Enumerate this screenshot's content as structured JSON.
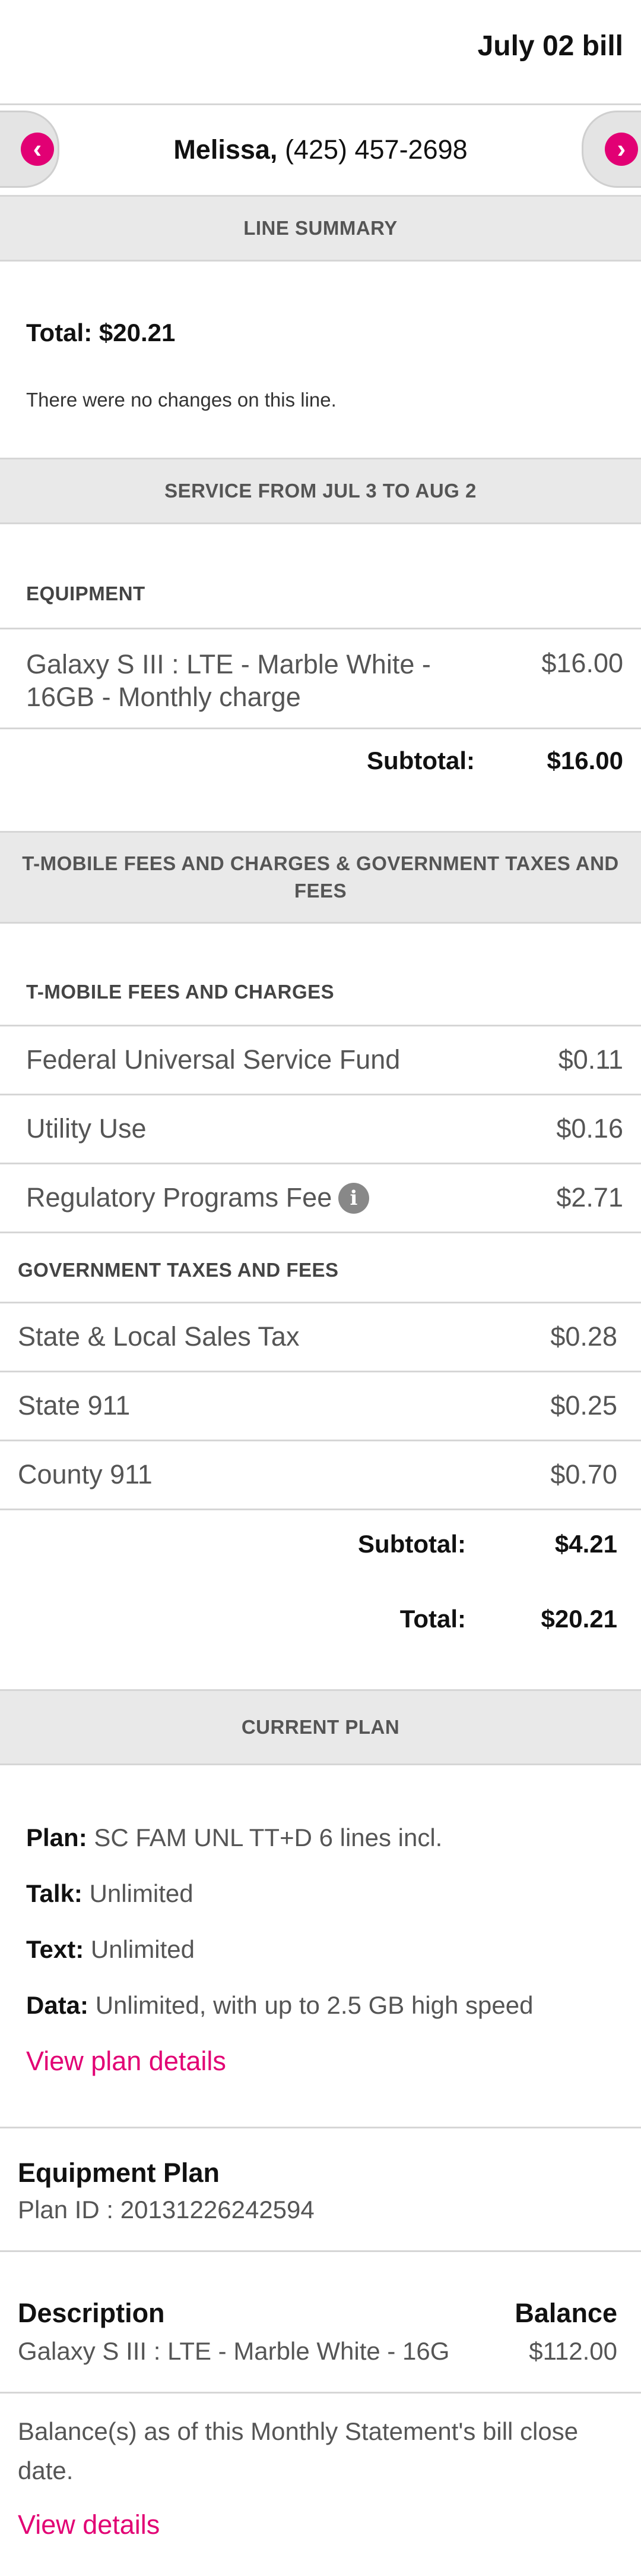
{
  "header": {
    "bill_title": "July 02 bill",
    "line_owner_name": "Melissa,",
    "line_phone": "(425) 457-2698"
  },
  "line_summary": {
    "heading": "LINE SUMMARY",
    "total": "Total: $20.21",
    "note": "There were no changes on this line."
  },
  "service": {
    "heading": "SERVICE FROM JUL 3 TO AUG 2",
    "equipment_heading": "EQUIPMENT",
    "equipment_item_line1": "Galaxy S III : LTE - Marble White -",
    "equipment_item_line2": "16GB - Monthly charge",
    "equipment_amount": "$16.00",
    "subtotal_label": "Subtotal:",
    "subtotal_amount": "$16.00"
  },
  "fees": {
    "heading_line1": "T-MOBILE FEES AND CHARGES & GOVERNMENT TAXES AND",
    "heading_line2": "FEES",
    "tmobile_heading": "T-MOBILE FEES AND CHARGES",
    "tmobile_items": [
      {
        "label": "Federal Universal Service Fund",
        "amount": "$0.11"
      },
      {
        "label": "Utility Use",
        "amount": "$0.16"
      },
      {
        "label": "Regulatory Programs Fee",
        "amount": "$2.71"
      }
    ],
    "gov_heading": "GOVERNMENT TAXES AND FEES",
    "gov_items": [
      {
        "label": "State & Local Sales Tax",
        "amount": "$0.28"
      },
      {
        "label": "State 911",
        "amount": "$0.25"
      },
      {
        "label": "County 911",
        "amount": "$0.70"
      }
    ],
    "subtotal_label": "Subtotal:",
    "subtotal_amount": "$4.21",
    "total_label": "Total:",
    "total_amount": "$20.21"
  },
  "current_plan": {
    "heading": "CURRENT PLAN",
    "plan_label": "Plan:",
    "plan_value": "SC FAM UNL TT+D 6 lines incl.",
    "talk_label": "Talk:",
    "talk_value": "Unlimited",
    "text_label": "Text:",
    "text_value": "Unlimited",
    "data_label": "Data:",
    "data_value": "Unlimited, with up to 2.5 GB high speed",
    "view_plan_link": "View plan details"
  },
  "equipment_plan": {
    "title": "Equipment Plan",
    "plan_id": "Plan ID : 20131226242594",
    "description_header": "Description",
    "balance_header": "Balance",
    "item_description": "Galaxy S III : LTE - Marble White - 16G",
    "item_balance": "$112.00",
    "balance_note_line1": "Balance(s) as of this Monthly Statement's bill close",
    "balance_note_line2": "date.",
    "view_details_link": "View details"
  },
  "icons": {
    "prev": "chevron-left-icon",
    "next": "chevron-right-icon",
    "info": "info-icon"
  },
  "colors": {
    "accent": "#e20074",
    "band_bg": "#e9e9e9"
  }
}
